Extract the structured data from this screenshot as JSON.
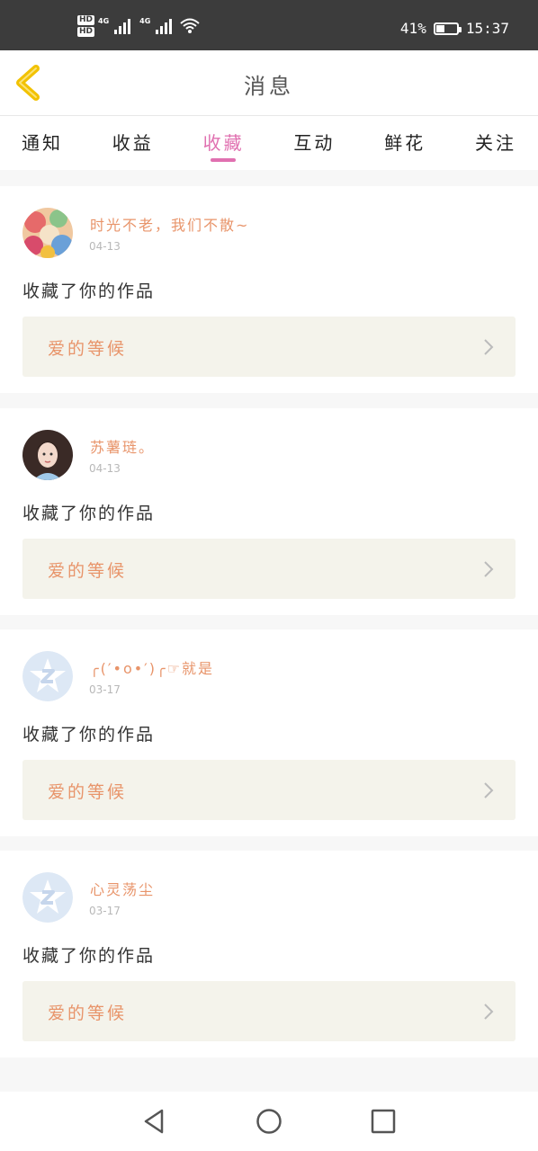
{
  "status_bar": {
    "hd1": "HD",
    "hd2": "HD",
    "net1": "4G",
    "net2": "4G",
    "battery_percent": "41%",
    "battery_level": 0.41,
    "time": "15:37"
  },
  "header": {
    "title": "消息"
  },
  "tabs": [
    {
      "label": "通知",
      "active": false
    },
    {
      "label": "收益",
      "active": false
    },
    {
      "label": "收藏",
      "active": true
    },
    {
      "label": "互动",
      "active": false
    },
    {
      "label": "鲜花",
      "active": false
    },
    {
      "label": "关注",
      "active": false
    }
  ],
  "notifications": [
    {
      "username": "时光不老，我们不散~",
      "date": "04-13",
      "action": "收藏了你的作品",
      "work_title": "爱的等候",
      "avatar": "photo-avatar-colorful"
    },
    {
      "username": "苏薯琏。",
      "date": "04-13",
      "action": "收藏了你的作品",
      "work_title": "爱的等候",
      "avatar": "photo-avatar-girl"
    },
    {
      "username": "╭(′•ο•′)╭☞就是",
      "date": "03-17",
      "action": "收藏了你的作品",
      "work_title": "爱的等候",
      "avatar": "qq-default-avatar"
    },
    {
      "username": "心灵荡尘",
      "date": "03-17",
      "action": "收藏了你的作品",
      "work_title": "爱的等候",
      "avatar": "qq-default-avatar"
    }
  ],
  "colors": {
    "accent_pink": "#e070b0",
    "username_orange": "#e8946a",
    "back_arrow": "#f2c200",
    "work_bg": "#f4f3eb"
  },
  "nav": {
    "icons": [
      "back-triangle-icon",
      "home-circle-icon",
      "recents-square-icon"
    ]
  }
}
